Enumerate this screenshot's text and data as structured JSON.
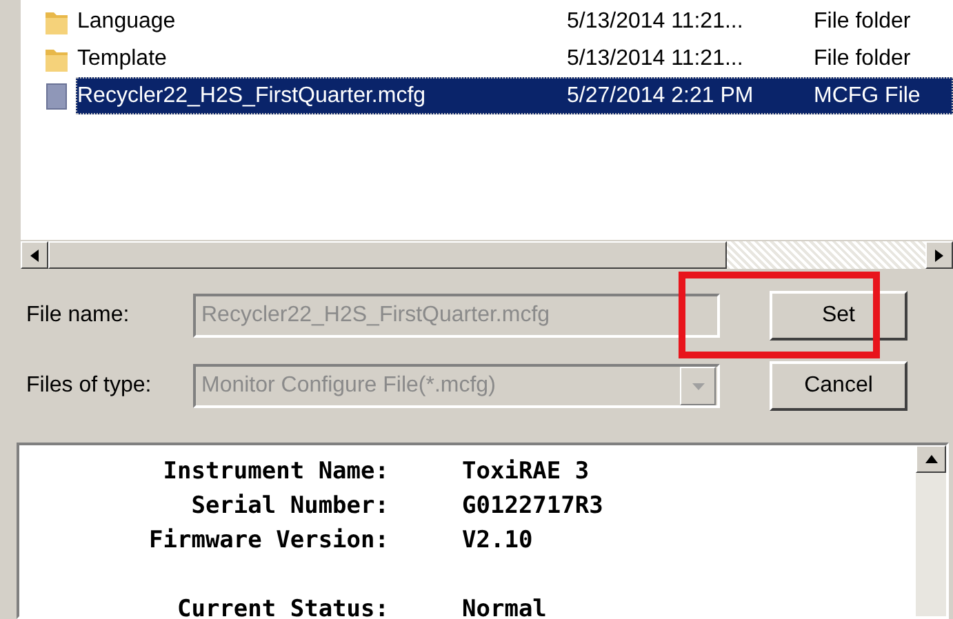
{
  "file_list": {
    "rows": [
      {
        "kind": "folder",
        "name": "Language",
        "date_modified": "5/13/2014 11:21...",
        "type": "File folder",
        "selected": false
      },
      {
        "kind": "folder",
        "name": "Template",
        "date_modified": "5/13/2014 11:21...",
        "type": "File folder",
        "selected": false
      },
      {
        "kind": "file",
        "name": "Recycler22_H2S_FirstQuarter.mcfg",
        "date_modified": "5/27/2014 2:21 PM",
        "type": "MCFG File",
        "selected": true
      }
    ]
  },
  "file_name": {
    "label": "File name:",
    "value": "Recycler22_H2S_FirstQuarter.mcfg",
    "disabled": true
  },
  "files_of_type": {
    "label": "Files of type:",
    "value": "Monitor Configure File(*.mcfg)",
    "disabled": true
  },
  "buttons": [
    {
      "label": "Set",
      "highlighted": true
    },
    {
      "label": "Cancel",
      "highlighted": false
    }
  ],
  "info": {
    "sections": [
      {
        "lines": [
          {
            "label": "Instrument Name:",
            "value": "ToxiRAE 3"
          },
          {
            "label": "Serial Number:",
            "value": "G0122717R3"
          },
          {
            "label": "Firmware Version:",
            "value": "V2.10"
          }
        ]
      },
      {
        "lines": [
          {
            "label": "Current Status:",
            "value": "Normal"
          }
        ]
      }
    ]
  }
}
